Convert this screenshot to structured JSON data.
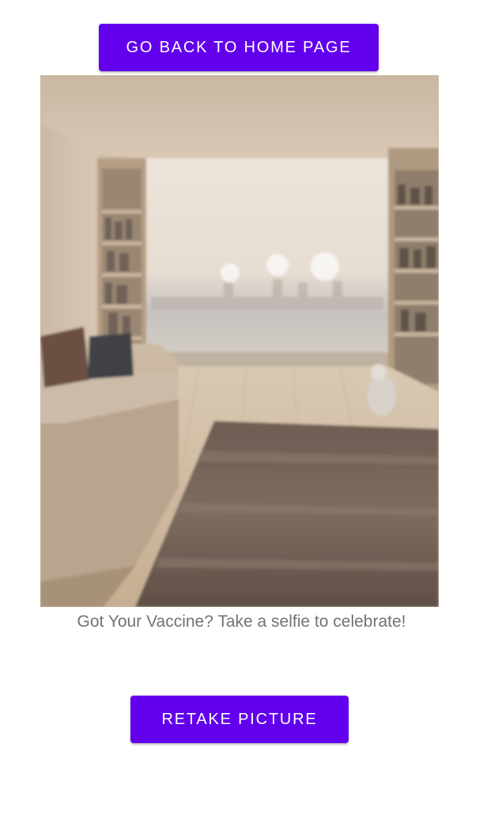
{
  "header": {
    "home_button_label": "Go back to home page"
  },
  "photo": {
    "description_icon": "room-photo"
  },
  "caption": {
    "text": "Got Your Vaccine? Take a selfie to celebrate!"
  },
  "footer": {
    "retake_button_label": "Retake picture"
  },
  "colors": {
    "primary": "#6200ee",
    "button_text": "#ffffff",
    "caption_text": "#737373",
    "background": "#ffffff"
  }
}
